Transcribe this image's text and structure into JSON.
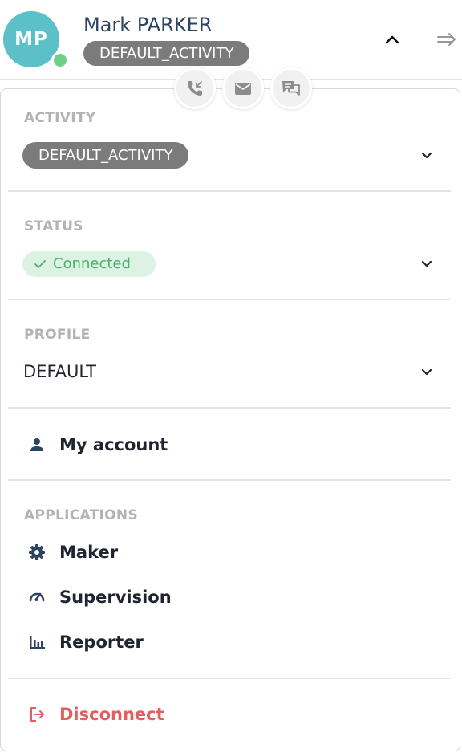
{
  "user": {
    "initials": "MP",
    "name": "Mark PARKER",
    "current_activity": "DEFAULT_ACTIVITY",
    "presence_color": "#6fcf86",
    "avatar_color": "#5bc0c8"
  },
  "header": {
    "collapse_icon": "chevron-up-icon",
    "exit_icon": "arrow-right-icon"
  },
  "actions": [
    {
      "name": "incoming-call",
      "icon": "phone-incoming-icon"
    },
    {
      "name": "email",
      "icon": "envelope-icon"
    },
    {
      "name": "chat",
      "icon": "chat-bubbles-icon"
    }
  ],
  "activity": {
    "label": "ACTIVITY",
    "value": "DEFAULT_ACTIVITY"
  },
  "status": {
    "label": "STATUS",
    "value": "Connected",
    "color": "#4caf6c"
  },
  "profile": {
    "label": "PROFILE",
    "value": "DEFAULT"
  },
  "account": {
    "label": "My account",
    "icon": "person-icon"
  },
  "applications": {
    "label": "APPLICATIONS",
    "items": [
      {
        "label": "Maker",
        "icon": "gear-icon"
      },
      {
        "label": "Supervision",
        "icon": "speedometer-icon"
      },
      {
        "label": "Reporter",
        "icon": "bar-chart-icon"
      }
    ]
  },
  "disconnect": {
    "label": "Disconnect",
    "icon": "logout-icon",
    "color": "#e06060"
  }
}
